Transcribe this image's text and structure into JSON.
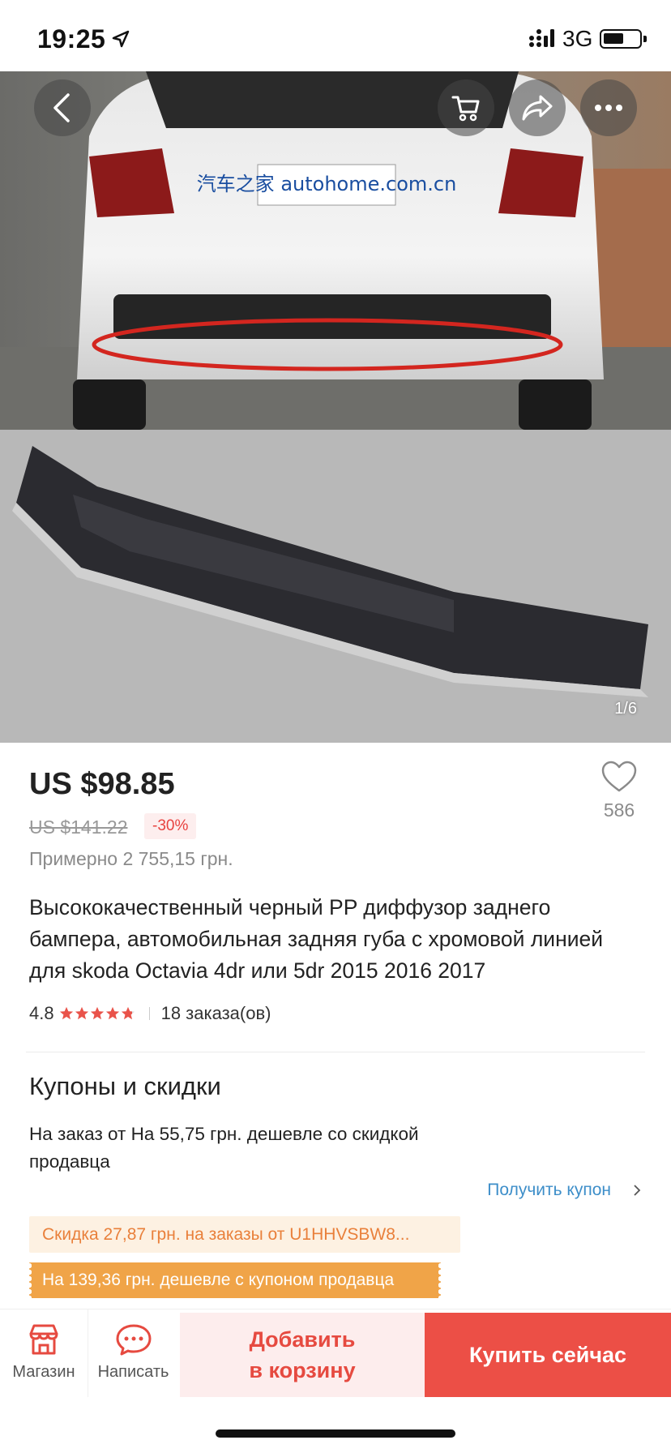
{
  "status_bar": {
    "time": "19:25",
    "network": "3G",
    "icons": [
      "location-arrow-icon",
      "signal-icon",
      "battery-icon"
    ]
  },
  "gallery": {
    "page_indicator": "1/6",
    "watermark": "汽车之家 autohome.com.cn",
    "buttons": [
      "back-icon",
      "cart-icon",
      "share-icon",
      "more-icon"
    ]
  },
  "product": {
    "price": "US $98.85",
    "old_price": "US $141.22",
    "discount": "-30%",
    "approx_price": "Примерно 2 755,15 грн.",
    "wishlist_count": "586",
    "title": "Высококачественный черный PP диффузор заднего бампера, автомобильная задняя губа с хромовой линией для skoda Octavia 4dr или 5dr 2015 2016 2017",
    "rating": "4.8",
    "rating_stars": 4.8,
    "orders": "18 заказа(ов)"
  },
  "coupons": {
    "heading": "Купоны и скидки",
    "description": "На заказ от На 55,75 грн. дешевле со скидкой продавца",
    "get_coupon": "Получить купон",
    "tag_1": "Скидка 27,87 грн. на заказы от U1HHVSBW8...",
    "tag_2": "На 139,36 грн. дешевле с купоном продавца"
  },
  "bottom_bar": {
    "shop_label": "Магазин",
    "message_label": "Написать",
    "add_to_cart_line1": "Добавить",
    "add_to_cart_line2": "в корзину",
    "buy_now": "Купить сейчас"
  },
  "colors": {
    "accent_red": "#ec4f46",
    "discount_red": "#e8423f",
    "coupon_orange": "#f0a448",
    "link_blue": "#3d8ec9"
  }
}
